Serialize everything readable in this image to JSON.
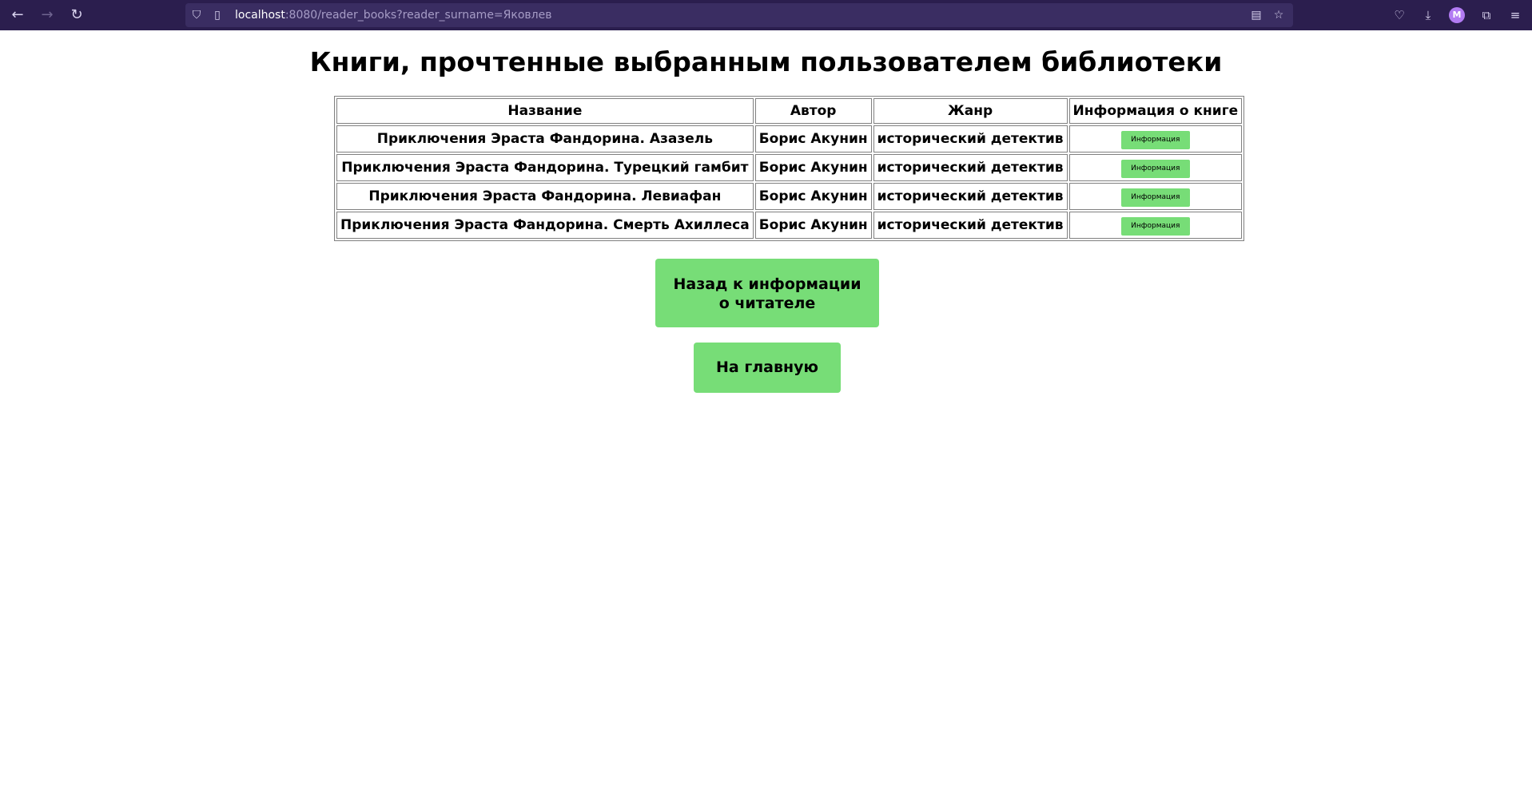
{
  "browser": {
    "url_host": "localhost",
    "url_rest": ":8080/reader_books?reader_surname=Яковлев",
    "profile_initial": "M"
  },
  "page": {
    "title": "Книги, прочтенные выбранным пользователем библиотеки"
  },
  "table": {
    "headers": [
      "Название",
      "Автор",
      "Жанр",
      "Информация о книге"
    ],
    "rows": [
      {
        "title": "Приключения Эраста Фандорина. Азазель",
        "author": "Борис Акунин",
        "genre": "исторический детектив",
        "button": "Информация"
      },
      {
        "title": "Приключения Эраста Фандорина. Турецкий гамбит",
        "author": "Борис Акунин",
        "genre": "исторический детектив",
        "button": "Информация"
      },
      {
        "title": "Приключения Эраста Фандорина. Левиафан",
        "author": "Борис Акунин",
        "genre": "исторический детектив",
        "button": "Информация"
      },
      {
        "title": "Приключения Эраста Фандорина. Смерть Ахиллеса",
        "author": "Борис Акунин",
        "genre": "исторический детектив",
        "button": "Информация"
      }
    ]
  },
  "buttons": {
    "back_line1": "Назад к информации",
    "back_line2": "о читателе",
    "home": "На главную"
  },
  "colors": {
    "toolbar_bg": "#2b1e4e",
    "button_green": "#77dd77"
  }
}
